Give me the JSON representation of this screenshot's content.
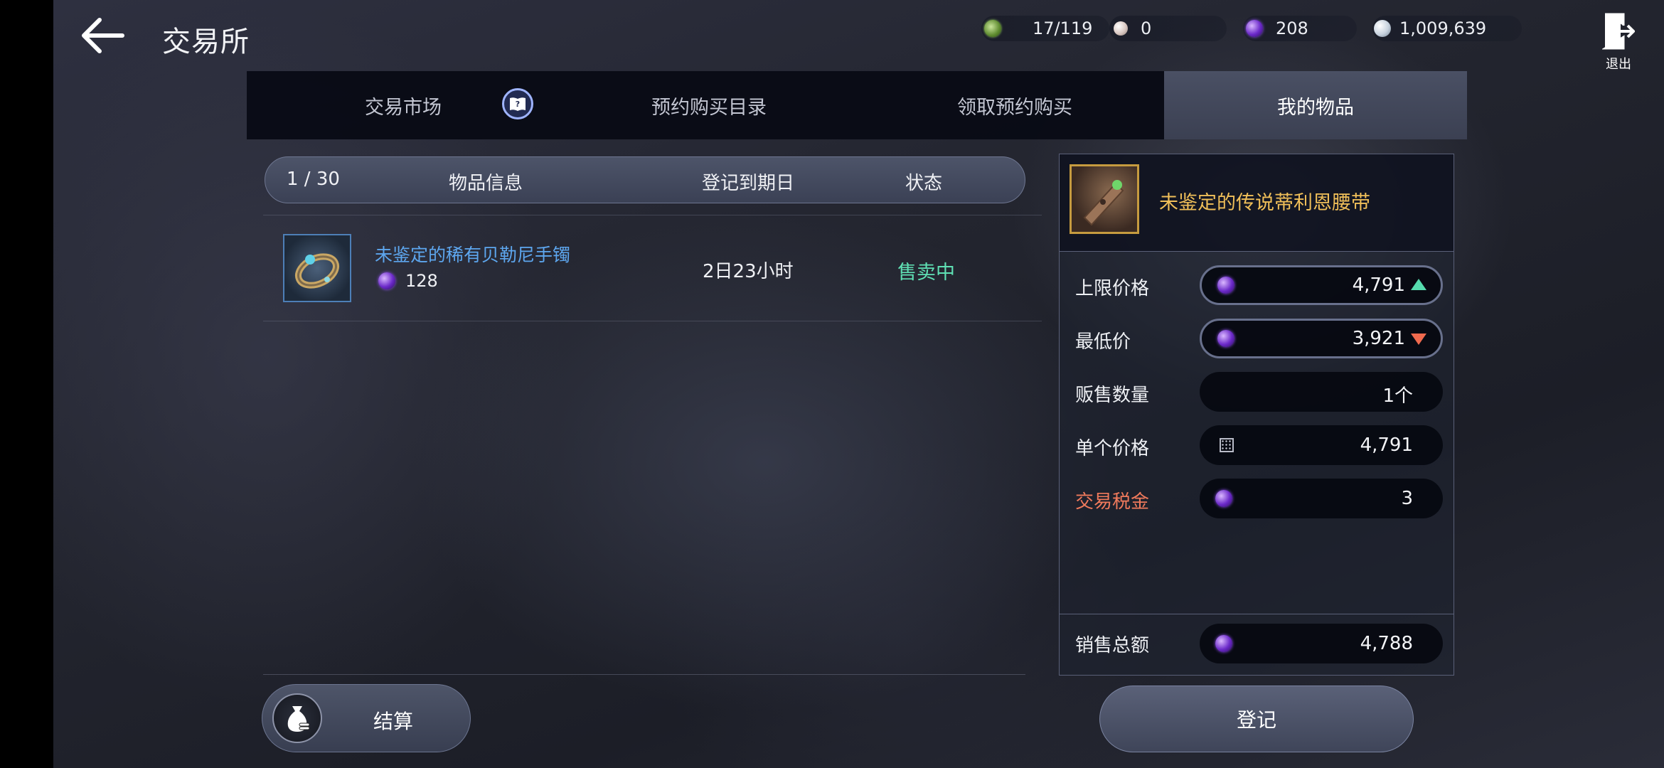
{
  "header": {
    "title": "交易所",
    "exit_label": "退出"
  },
  "resources": [
    {
      "icon": "green-token-icon",
      "value": "17/119"
    },
    {
      "icon": "pearl-icon",
      "value": "0"
    },
    {
      "icon": "purple-gem-icon",
      "value": "208"
    },
    {
      "icon": "silver-coin-icon",
      "value": "1,009,639"
    }
  ],
  "tabs": [
    {
      "label": "交易市场",
      "active": false
    },
    {
      "label": "预约购买目录",
      "active": false
    },
    {
      "label": "领取预约购买",
      "active": false
    },
    {
      "label": "我的物品",
      "active": true
    }
  ],
  "list": {
    "count": "1 / 30",
    "col_info": "物品信息",
    "col_expire": "登记到期日",
    "col_status": "状态",
    "rows": [
      {
        "name": "未鉴定的稀有贝勒尼手镯",
        "price": "128",
        "expire": "2日23小时",
        "status": "售卖中"
      }
    ]
  },
  "settle_label": "结算",
  "panel": {
    "item_name": "未鉴定的传说蒂利恩腰带",
    "max_price_label": "上限价格",
    "max_price": "4,791",
    "min_price_label": "最低价",
    "min_price": "3,921",
    "quantity_label": "贩售数量",
    "quantity": "1个",
    "unit_price_label": "单个价格",
    "unit_price": "4,791",
    "tax_label": "交易税金",
    "tax": "3",
    "total_label": "销售总额",
    "total": "4,788"
  },
  "register_label": "登记",
  "colors": {
    "item_name_rare": "#5da6ee",
    "item_name_legend": "#f0bf59",
    "status_selling": "#5fe0b4",
    "tax_label": "#f07a5c",
    "up_arrow": "#56dcae",
    "down_arrow": "#f06a4e"
  }
}
